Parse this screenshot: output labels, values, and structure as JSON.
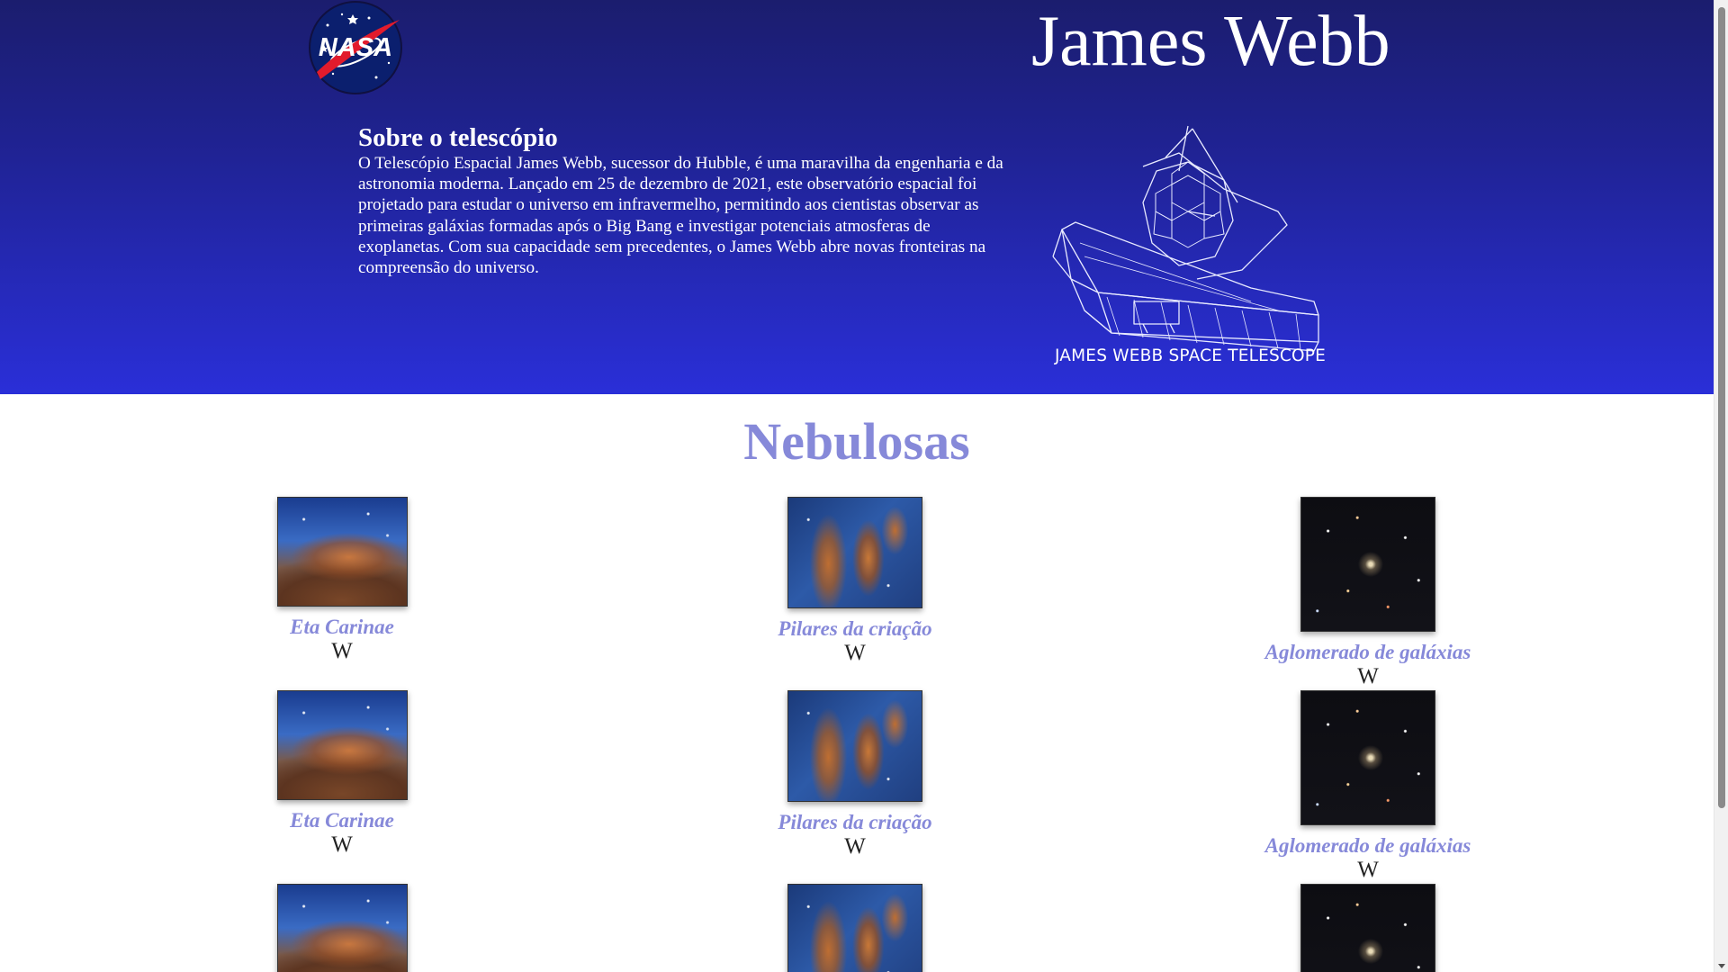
{
  "header": {
    "logo_text": "NASA",
    "title": "James Webb",
    "about_heading": "Sobre o telescópio",
    "about_text": "O Telescópio Espacial James Webb, sucessor do Hubble, é uma maravilha da engenharia e da astronomia moderna. Lançado em 25 de dezembro de 2021, este observatório espacial foi projetado para estudar o universo em infravermelho, permitindo aos cientistas observar as primeiras galáxias formadas após o Big Bang e investigar potenciais atmosferas de exoplanetas. Com sua capacidade sem precedentes, o James Webb abre novas fronteiras na compreensão do universo.",
    "telescope_caption": "JAMES WEBB SPACE TELESCOPE"
  },
  "gallery": {
    "title": "Nebulosas",
    "wiki_glyph": "W",
    "cards": [
      {
        "caption": "Eta Carinae"
      },
      {
        "caption": "Pilares da criação"
      },
      {
        "caption": "Aglomerado de galáxias"
      },
      {
        "caption": "Eta Carinae"
      },
      {
        "caption": "Pilares da criação"
      },
      {
        "caption": "Aglomerado de galáxias"
      },
      {
        "caption": ""
      },
      {
        "caption": ""
      },
      {
        "caption": ""
      }
    ]
  },
  "colors": {
    "header_top": "#1b1d6e",
    "header_bottom": "#2a2fd8",
    "accent": "#8689d9"
  }
}
